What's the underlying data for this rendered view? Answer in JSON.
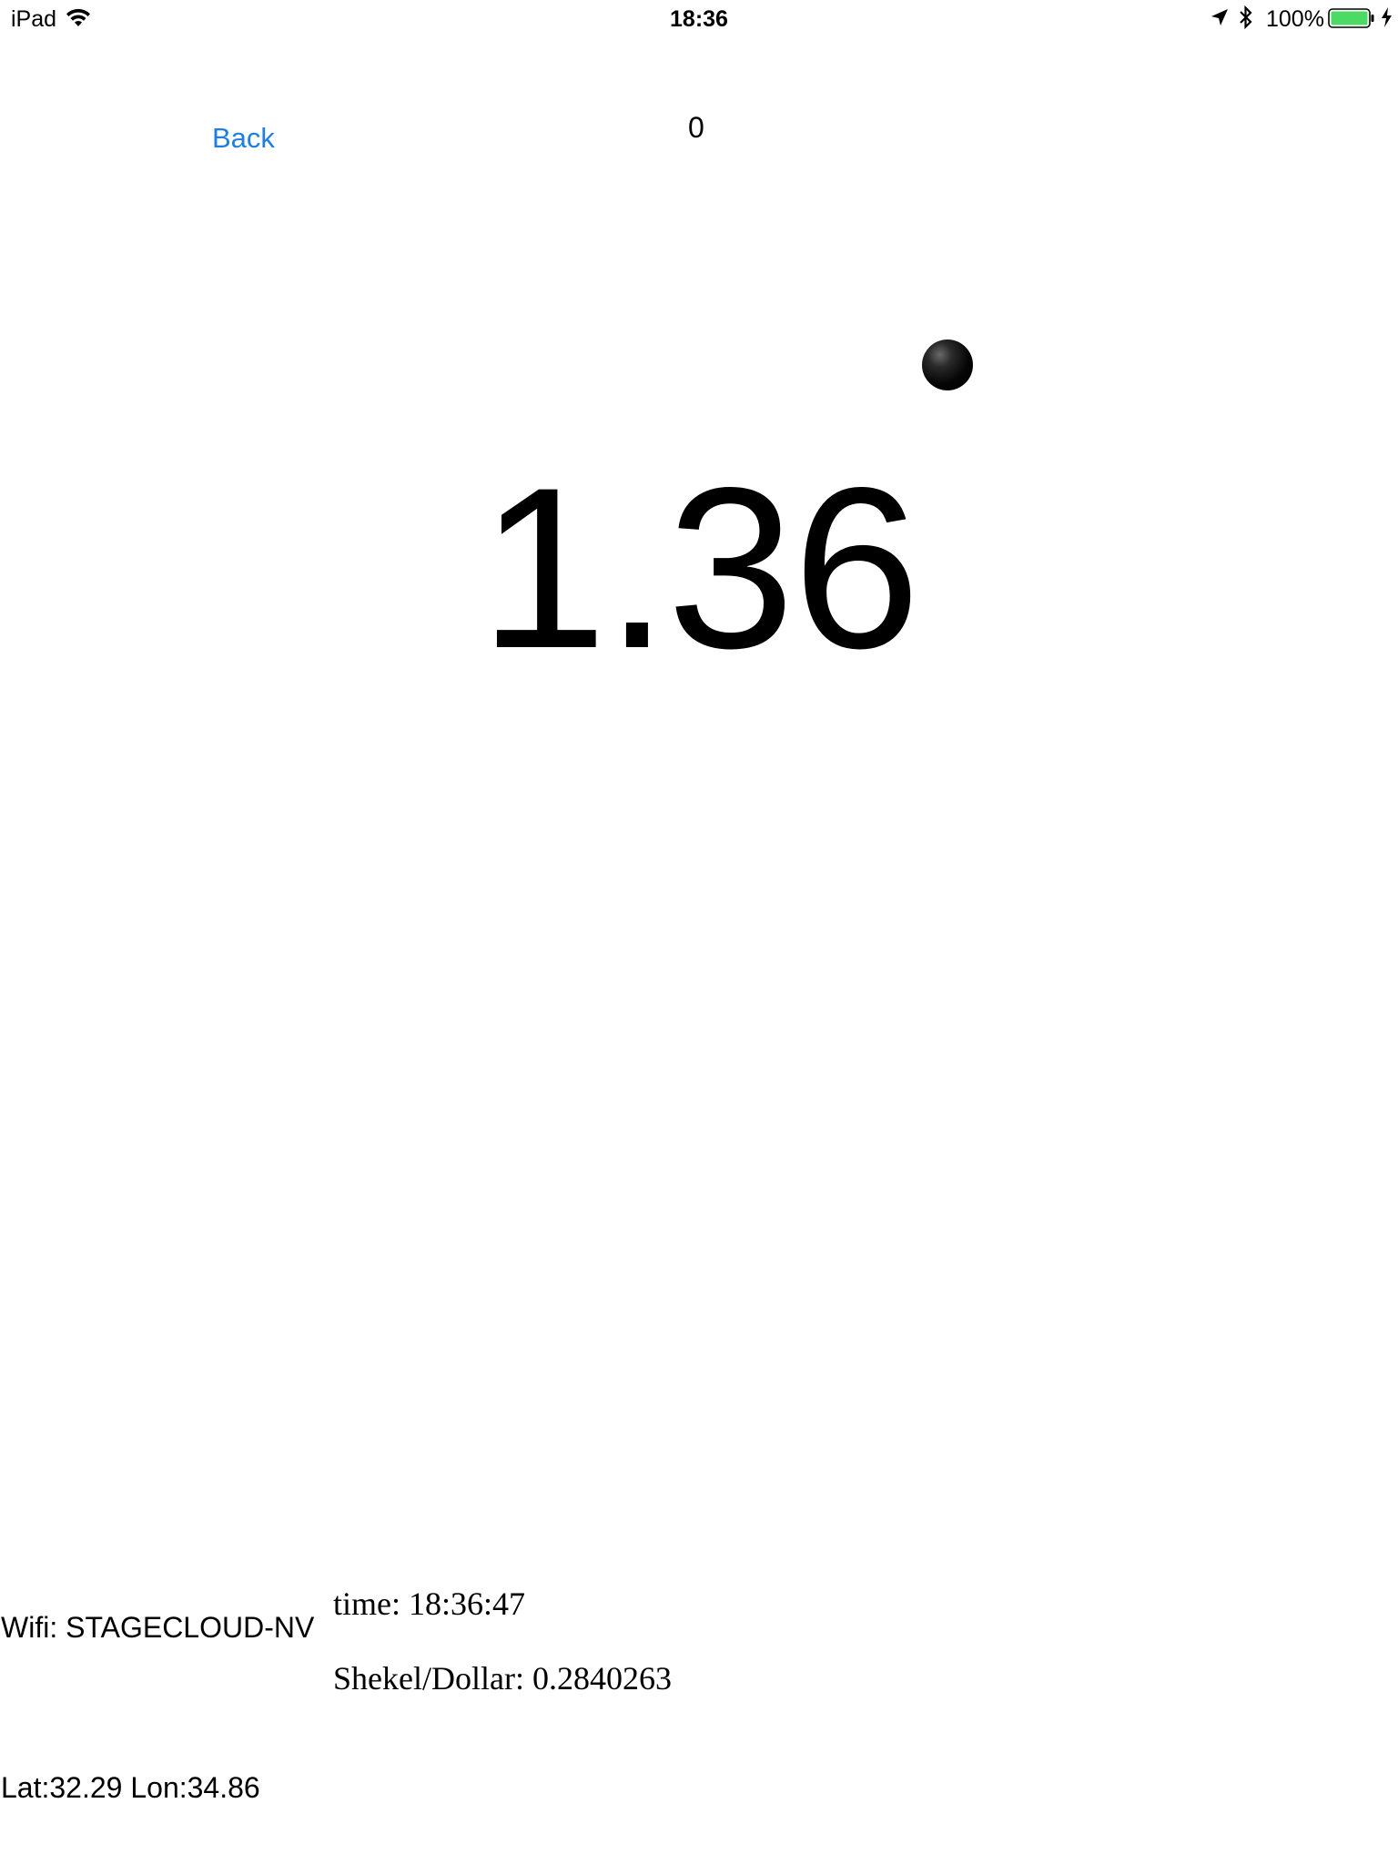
{
  "status_bar": {
    "device": "iPad",
    "time": "18:36",
    "battery_percent": "100%",
    "icons": [
      "wifi-icon",
      "location-arrow-icon",
      "bluetooth-icon",
      "battery-icon",
      "charging-bolt-icon"
    ],
    "battery_color": "#4cd964"
  },
  "nav": {
    "back_label": "Back",
    "counter": "0",
    "accent_color": "#1f7fe0"
  },
  "main": {
    "value": "1.36",
    "ball_icon": "ball-icon"
  },
  "info": {
    "wifi": "Wifi: STAGECLOUD-NV",
    "time": "time: 18:36:47",
    "rate": "Shekel/Dollar: 0.2840263",
    "location": "Lat:32.29 Lon:34.86"
  }
}
